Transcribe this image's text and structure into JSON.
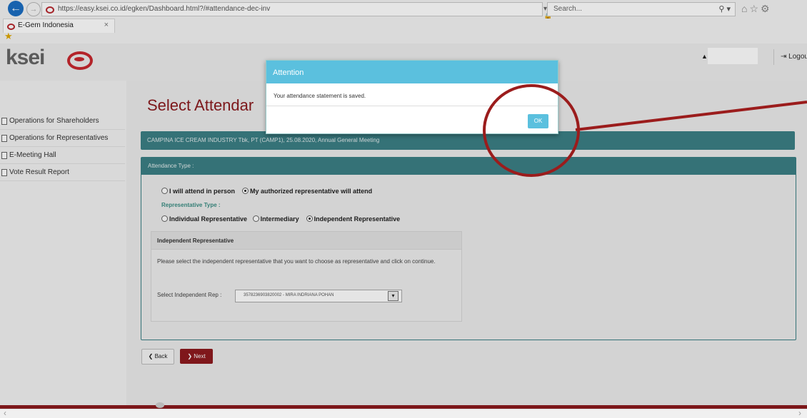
{
  "browser": {
    "url": "https://easy.ksei.co.id/egken/Dashboard.html?/#attendance-dec-inv",
    "search_placeholder": "Search...",
    "tab_title": "E-Gem Indonesia",
    "tab_close": "×",
    "back_glyph": "←",
    "forward_glyph": "→",
    "url_controls": "▾ 🔒 C",
    "search_controls": "⚲ ▾",
    "toolbar_icons": "⌂☆⚙"
  },
  "header": {
    "logo": "ksei",
    "logo_sub": "",
    "logout": "Logou"
  },
  "sidebar": {
    "items": [
      {
        "label": "Operations for Shareholders"
      },
      {
        "label": "Operations for Representatives"
      },
      {
        "label": "E-Meeting Hall"
      },
      {
        "label": "Vote Result Report"
      }
    ]
  },
  "main": {
    "title": "Select Attendar",
    "meeting": "CAMPINA ICE CREAM INDUSTRY Tbk, PT (CAMP1), 25.08.2020, Annual General Meeting",
    "attendance_type_label": "Attendance Type :",
    "options": {
      "in_person": "I will attend in person",
      "authorized": "My authorized representative will attend",
      "selected": "authorized"
    },
    "rep_type_label": "Representative Type :",
    "rep_options": {
      "individual": "Individual Representative",
      "intermediary": "Intermediary",
      "independent": "Independent Representative",
      "selected": "independent"
    },
    "independent_panel": {
      "title": "Independent Representative",
      "description": "Please select the independent representative that you want to choose as representative and click on continue.",
      "select_label": "Select Independent Rep :",
      "select_value": "3578236903820002 - MIRA INDRIANA POHAN"
    },
    "back_label": "❮ Back",
    "next_label": "❯ Next"
  },
  "dialog": {
    "title": "Attention",
    "message": "Your attendance statement is saved.",
    "ok_label": "OK"
  },
  "colors": {
    "accent_teal": "#3b7f85",
    "dialog_blue": "#5bc0de",
    "brand_red": "#8b1a1e",
    "annotation_red": "#9b1c1c"
  }
}
